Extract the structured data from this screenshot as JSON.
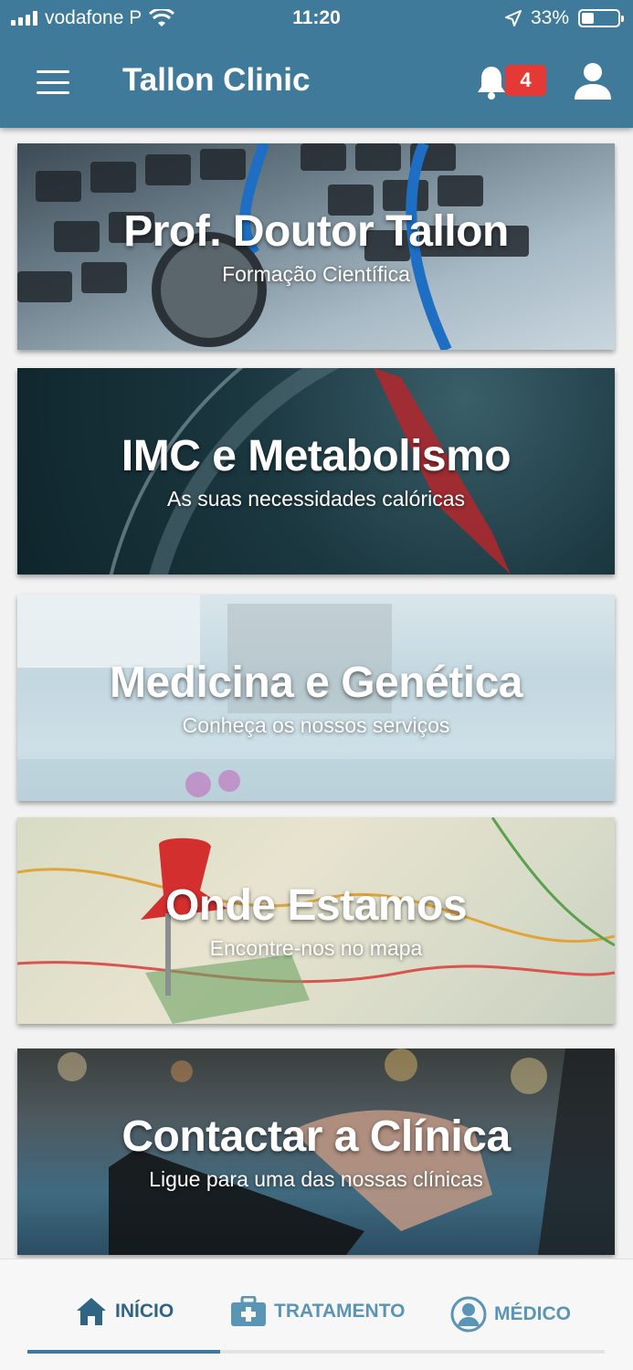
{
  "status_bar": {
    "carrier": "vodafone P",
    "time": "11:20",
    "battery": "33%",
    "battery_level": 0.33
  },
  "header": {
    "title": "Tallon Clinic",
    "notification_count": "4"
  },
  "cards": [
    {
      "title": "Prof. Doutor Tallon",
      "subtitle": "Formação Científica"
    },
    {
      "title": "IMC e Metabolismo",
      "subtitle": "As suas necessidades calóricas"
    },
    {
      "title": "Medicina e Genética",
      "subtitle": "Conheça os nossos serviços"
    },
    {
      "title": "Onde Estamos",
      "subtitle": "Encontre-nos no mapa"
    },
    {
      "title": "Contactar a Clínica",
      "subtitle": "Ligue para uma das nossas clínicas"
    }
  ],
  "bottom_nav": {
    "tabs": [
      {
        "label": "INÍCIO",
        "icon": "home-icon",
        "active": true
      },
      {
        "label": "TRATAMENTO",
        "icon": "medical-kit-icon",
        "active": false
      },
      {
        "label": "MÉDICO",
        "icon": "doctor-icon",
        "active": false
      }
    ]
  },
  "colors": {
    "brand": "#3f7a9b",
    "badge": "#e53935"
  }
}
